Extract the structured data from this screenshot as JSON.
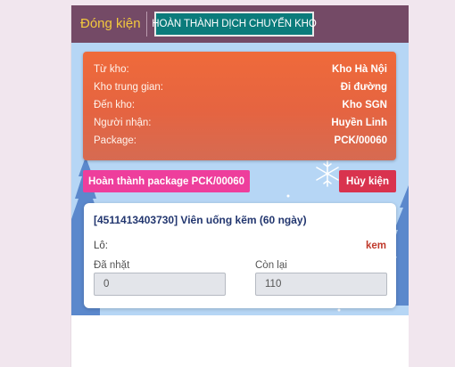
{
  "header": {
    "title": "Đóng kiện",
    "complete_transfer_label": "HOÀN THÀNH DỊCH CHUYỂN KHO"
  },
  "info": {
    "rows": [
      {
        "label": "Từ kho:",
        "value": "Kho Hà Nội"
      },
      {
        "label": "Kho trung gian:",
        "value": "Đi đường"
      },
      {
        "label": "Đến kho:",
        "value": "Kho SGN"
      },
      {
        "label": "Người nhận:",
        "value": "Huyền Linh"
      },
      {
        "label": "Package:",
        "value": "PCK/00060"
      }
    ]
  },
  "actions": {
    "complete_package_label": "Hoàn thành package PCK/00060",
    "cancel_label": "Hủy kiện"
  },
  "product": {
    "title": "[4511413403730] Viên uống kẽm (60 ngày)",
    "lot_label": "Lô:",
    "lot_value": "kem",
    "picked_label": "Đã nhặt",
    "picked_value": "0",
    "remaining_label": "Còn lại",
    "remaining_value": "110"
  },
  "colors": {
    "header": "#744a66",
    "header_title": "#f3c93d",
    "complete_transfer_button": "#0b7b7b",
    "info_card": "#e56441",
    "package_button": "#ee3e9c",
    "cancel_button": "#d9334e",
    "product_title": "#22366f",
    "lot_value": "#c0392b",
    "scene_background": "#b6d6f5",
    "trees": "#5b88cc"
  },
  "icons": {
    "snowflake": "snowflake-icon"
  }
}
